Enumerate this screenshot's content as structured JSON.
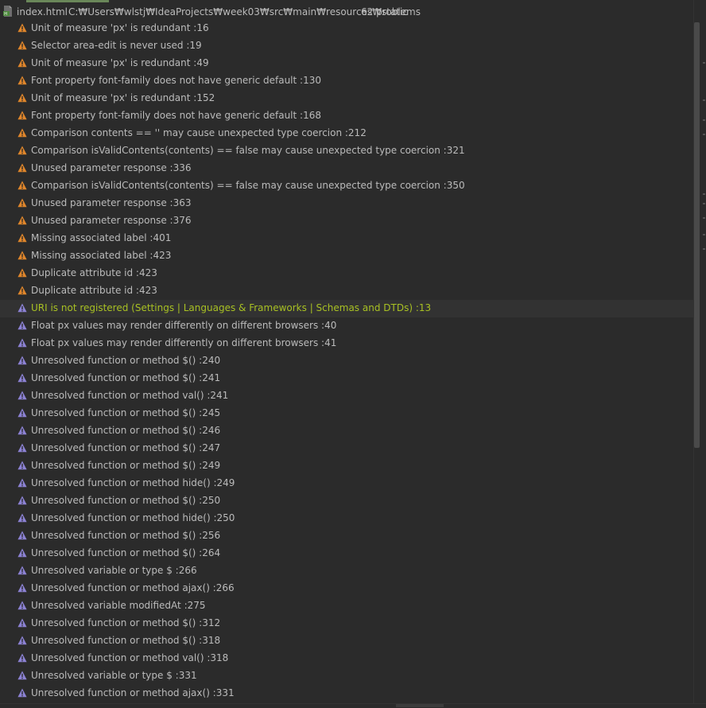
{
  "colors": {
    "background": "#2b2b2b",
    "text": "#bbbbbb",
    "selected_text": "#a8c023",
    "warning_icon": "#e0862b",
    "weak_warning_icon": "#8c82d4"
  },
  "file": {
    "icon": "html-file-icon",
    "name": "index.html",
    "path": "C:₩Users₩wlstj₩IdeaProjects₩week03₩src₩main₩resources₩static",
    "problem_count": "62 problems"
  },
  "problems": [
    {
      "severity": "warning",
      "text": "Unit of measure 'px' is redundant :16"
    },
    {
      "severity": "warning",
      "text": "Selector area-edit is never used :19"
    },
    {
      "severity": "warning",
      "text": "Unit of measure 'px' is redundant :49"
    },
    {
      "severity": "warning",
      "text": "Font property font-family does not have generic default :130"
    },
    {
      "severity": "warning",
      "text": "Unit of measure 'px' is redundant :152"
    },
    {
      "severity": "warning",
      "text": "Font property font-family does not have generic default :168"
    },
    {
      "severity": "warning",
      "text": "Comparison contents == '' may cause unexpected type coercion :212"
    },
    {
      "severity": "warning",
      "text": "Comparison isValidContents(contents) == false may cause unexpected type coercion :321"
    },
    {
      "severity": "warning",
      "text": "Unused parameter response :336"
    },
    {
      "severity": "warning",
      "text": "Comparison isValidContents(contents) == false may cause unexpected type coercion :350"
    },
    {
      "severity": "warning",
      "text": "Unused parameter response :363"
    },
    {
      "severity": "warning",
      "text": "Unused parameter response :376"
    },
    {
      "severity": "warning",
      "text": "Missing associated label :401"
    },
    {
      "severity": "warning",
      "text": "Missing associated label :423"
    },
    {
      "severity": "warning",
      "text": "Duplicate attribute id :423"
    },
    {
      "severity": "warning",
      "text": "Duplicate attribute id :423"
    },
    {
      "severity": "weak",
      "text": "URI is not registered (Settings | Languages & Frameworks | Schemas and DTDs) :13",
      "selected": true
    },
    {
      "severity": "weak",
      "text": "Float px values may render differently on different browsers :40"
    },
    {
      "severity": "weak",
      "text": "Float px values may render differently on different browsers :41"
    },
    {
      "severity": "weak",
      "text": "Unresolved function or method $() :240"
    },
    {
      "severity": "weak",
      "text": "Unresolved function or method $() :241"
    },
    {
      "severity": "weak",
      "text": "Unresolved function or method val() :241"
    },
    {
      "severity": "weak",
      "text": "Unresolved function or method $() :245"
    },
    {
      "severity": "weak",
      "text": "Unresolved function or method $() :246"
    },
    {
      "severity": "weak",
      "text": "Unresolved function or method $() :247"
    },
    {
      "severity": "weak",
      "text": "Unresolved function or method $() :249"
    },
    {
      "severity": "weak",
      "text": "Unresolved function or method hide() :249"
    },
    {
      "severity": "weak",
      "text": "Unresolved function or method $() :250"
    },
    {
      "severity": "weak",
      "text": "Unresolved function or method hide() :250"
    },
    {
      "severity": "weak",
      "text": "Unresolved function or method $() :256"
    },
    {
      "severity": "weak",
      "text": "Unresolved function or method $() :264"
    },
    {
      "severity": "weak",
      "text": "Unresolved variable or type $ :266"
    },
    {
      "severity": "weak",
      "text": "Unresolved function or method ajax() :266"
    },
    {
      "severity": "weak",
      "text": "Unresolved variable modifiedAt :275"
    },
    {
      "severity": "weak",
      "text": "Unresolved function or method $() :312"
    },
    {
      "severity": "weak",
      "text": "Unresolved function or method $() :318"
    },
    {
      "severity": "weak",
      "text": "Unresolved function or method val() :318"
    },
    {
      "severity": "weak",
      "text": "Unresolved variable or type $ :331"
    },
    {
      "severity": "weak",
      "text": "Unresolved function or method ajax() :331"
    }
  ]
}
